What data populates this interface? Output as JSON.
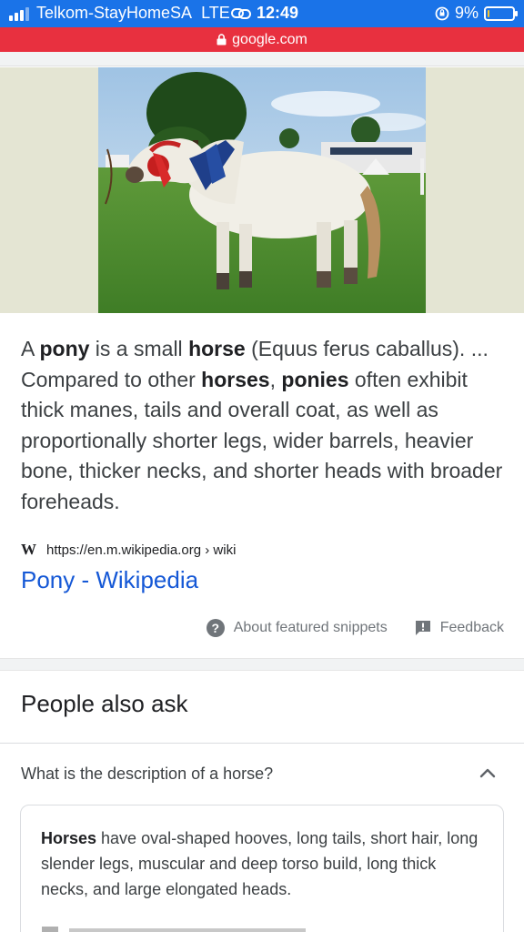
{
  "status_bar": {
    "carrier": "Telkom-StayHomeSA",
    "network": "LTE",
    "time": "12:49",
    "battery": "9%",
    "battery_level": 0.09
  },
  "url_bar": {
    "domain": "google.com"
  },
  "featured_snippet": {
    "image_description_icon": "pony-photo",
    "text": {
      "s1": "A ",
      "b1": "pony",
      "s2": " is a small ",
      "b2": "horse",
      "s3": " (Equus ferus caballus). ... Compared to other ",
      "b3": "horses",
      "s4": ", ",
      "b4": "ponies",
      "s5": " often exhibit thick manes, tails and overall coat, as well as proportionally shorter legs, wider barrels, heavier bone, thicker necks, and shorter heads with broader foreheads."
    },
    "source_logo": "W",
    "source_url": "https://en.m.wikipedia.org › wiki",
    "link_title": "Pony - Wikipedia",
    "about_label": "About featured snippets",
    "feedback_label": "Feedback"
  },
  "people_also_ask": {
    "title": "People also ask",
    "question": "What is the description of a horse?",
    "answer": {
      "b1": "Horses",
      "s1": " have oval-shaped hooves, long tails, short hair, long slender legs, muscular and deep torso build, long thick necks, and large elongated heads."
    }
  },
  "colors": {
    "status_blue": "#1a73e8",
    "url_red": "#e8303f",
    "link_blue": "#1558d6"
  }
}
